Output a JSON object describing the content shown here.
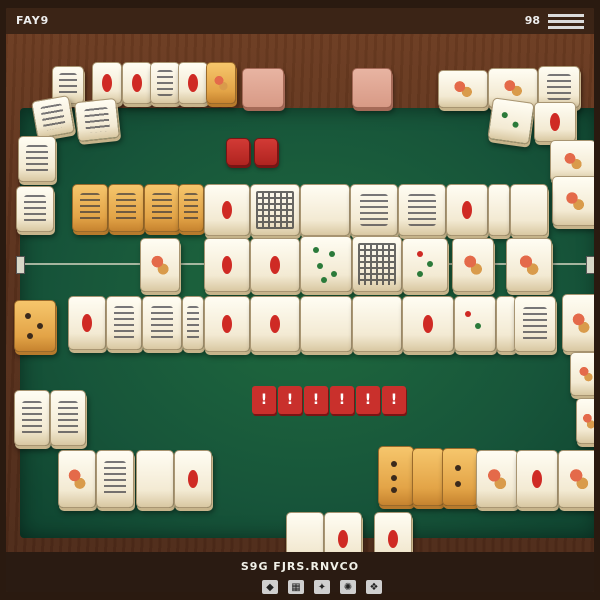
{
  "header": {
    "title": "FAY9",
    "score": "98"
  },
  "center_tiles": [
    "!",
    "!",
    "!",
    "!",
    "!",
    "!"
  ],
  "footer": {
    "text": "S9G FJRS.RNVCO",
    "icons": [
      "◆",
      "▦",
      "✦",
      "✺",
      "❖"
    ]
  },
  "colors": {
    "felt": "#17553a",
    "wood": "#5a311c",
    "tile_face": "#f3ead3",
    "accent_red": "#c9302c",
    "accent_orange": "#e3a447"
  }
}
